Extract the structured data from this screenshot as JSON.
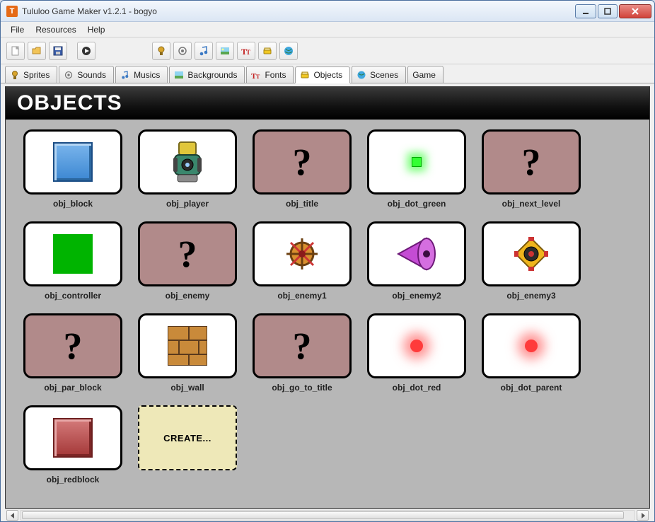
{
  "title": "Tululoo Game Maker v1.2.1 - bogyo",
  "menu": {
    "file": "File",
    "resources": "Resources",
    "help": "Help"
  },
  "toolbar": {
    "new": "new",
    "open": "open",
    "save": "save",
    "run": "run",
    "sprites": "sprites",
    "sounds": "sounds",
    "musics": "musics",
    "backgrounds": "backgrounds",
    "fonts": "fonts",
    "objects": "objects",
    "scenes": "scenes"
  },
  "tabs": [
    {
      "id": "sprites",
      "label": "Sprites"
    },
    {
      "id": "sounds",
      "label": "Sounds"
    },
    {
      "id": "musics",
      "label": "Musics"
    },
    {
      "id": "backgrounds",
      "label": "Backgrounds"
    },
    {
      "id": "fonts",
      "label": "Fonts"
    },
    {
      "id": "objects",
      "label": "Objects",
      "active": true
    },
    {
      "id": "scenes",
      "label": "Scenes"
    },
    {
      "id": "game",
      "label": "Game"
    }
  ],
  "panel": {
    "title": "OBJECTS",
    "create_label": "CREATE..."
  },
  "objects": [
    {
      "name": "obj_block",
      "sprite": "block"
    },
    {
      "name": "obj_player",
      "sprite": "player"
    },
    {
      "name": "obj_title",
      "sprite": "unknown"
    },
    {
      "name": "obj_dot_green",
      "sprite": "greendot"
    },
    {
      "name": "obj_next_level",
      "sprite": "unknown"
    },
    {
      "name": "obj_controller",
      "sprite": "greenrect"
    },
    {
      "name": "obj_enemy",
      "sprite": "unknown"
    },
    {
      "name": "obj_enemy1",
      "sprite": "enemy1"
    },
    {
      "name": "obj_enemy2",
      "sprite": "enemy2"
    },
    {
      "name": "obj_enemy3",
      "sprite": "enemy3"
    },
    {
      "name": "obj_par_block",
      "sprite": "unknown"
    },
    {
      "name": "obj_wall",
      "sprite": "wall"
    },
    {
      "name": "obj_go_to_title",
      "sprite": "unknown"
    },
    {
      "name": "obj_dot_red",
      "sprite": "reddot"
    },
    {
      "name": "obj_dot_parent",
      "sprite": "reddot"
    },
    {
      "name": "obj_redblock",
      "sprite": "redblock"
    }
  ]
}
